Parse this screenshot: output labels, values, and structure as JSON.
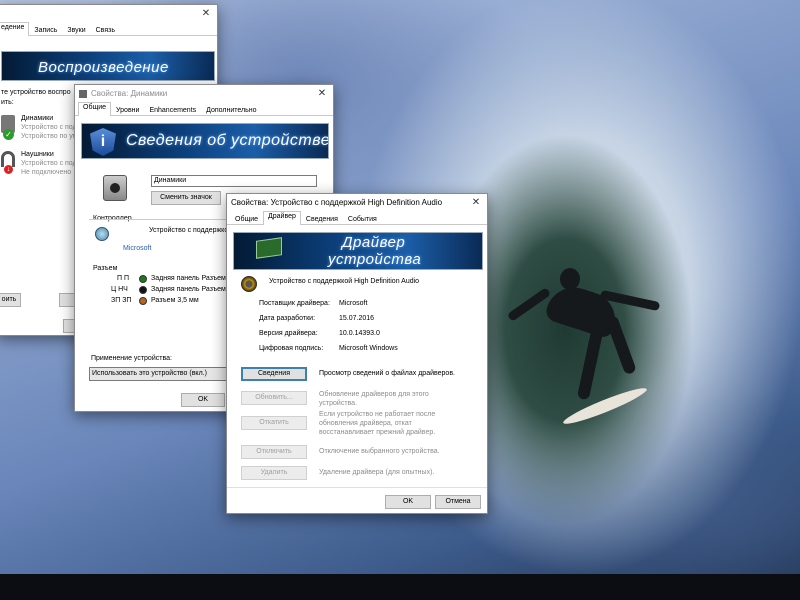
{
  "colors": {
    "banner": "#0c3f7a",
    "taskbar": "#0b0d12",
    "focus_border": "#3c7fb1",
    "jack_green": "#1c7a1c",
    "jack_black": "#111111",
    "jack_orange": "#b5651d"
  },
  "sound_window": {
    "tabs": [
      "едение",
      "Запись",
      "Звуки",
      "Связь"
    ],
    "banner_title": "Воспроизведение",
    "instruction": "те устройство воспро",
    "instruction2": "ить:",
    "devices": [
      {
        "name": "Динамики",
        "line1": "Устройство с под",
        "line2": "Устройство по ум",
        "status_icon": "check-icon"
      },
      {
        "name": "Наушники",
        "line1": "Устройство с под",
        "line2": "Не подключено",
        "status_icon": "unplugged-icon"
      }
    ],
    "configure_btn": "оить"
  },
  "speakers_window": {
    "title": "Свойства: Динамики",
    "tabs": [
      "Общие",
      "Уровни",
      "Enhancements",
      "Дополнительно"
    ],
    "banner_title": "Сведения об устройстве",
    "device_name_value": "Динамики",
    "change_icon_btn": "Сменить значок",
    "controller_label": "Контроллер",
    "controller_name": "Устройство с поддержкой",
    "controller_vendor": "Microsoft",
    "jacks_label": "Разъем",
    "jacks": [
      {
        "code": "П П",
        "text": "Задняя панель Разъем",
        "color": "green"
      },
      {
        "code": "Ц НЧ",
        "text": "Задняя панель Разъем",
        "color": "black"
      },
      {
        "code": "ЗП ЗП",
        "text": "Разъем 3,5 мм",
        "color": "orange"
      }
    ],
    "usage_label": "Применение устройства:",
    "usage_value": "Использовать это устройство (вкл.)",
    "ok_btn": "OK"
  },
  "driver_window": {
    "title": "Свойства: Устройство с поддержкой High Definition Audio",
    "tabs": [
      "Общие",
      "Драйвер",
      "Сведения",
      "События"
    ],
    "active_tab": "Драйвер",
    "banner_line1": "Драйвер",
    "banner_line2": "устройства",
    "device_name": "Устройство с поддержкой High Definition Audio",
    "info": [
      {
        "label": "Поставщик драйвера:",
        "value": "Microsoft"
      },
      {
        "label": "Дата разработки:",
        "value": "15.07.2016"
      },
      {
        "label": "Версия драйвера:",
        "value": "10.0.14393.0"
      },
      {
        "label": "Цифровая подпись:",
        "value": "Microsoft Windows"
      }
    ],
    "actions": [
      {
        "button": "Сведения",
        "desc": "Просмотр сведений о файлах драйверов.",
        "enabled": true
      },
      {
        "button": "Обновить...",
        "desc": "Обновление драйверов для этого\nустройства.",
        "enabled": false
      },
      {
        "button": "Откатить",
        "desc": "Если устройство не работает после\nобновления драйвера, откат\nвосстанавливает прежний драйвер.",
        "enabled": false
      },
      {
        "button": "Отключить",
        "desc": "Отключение выбранного устройства.",
        "enabled": false
      },
      {
        "button": "Удалить",
        "desc": "Удаление драйвера (для опытных).",
        "enabled": false
      }
    ],
    "ok_btn": "OK",
    "cancel_btn": "Отмена"
  }
}
